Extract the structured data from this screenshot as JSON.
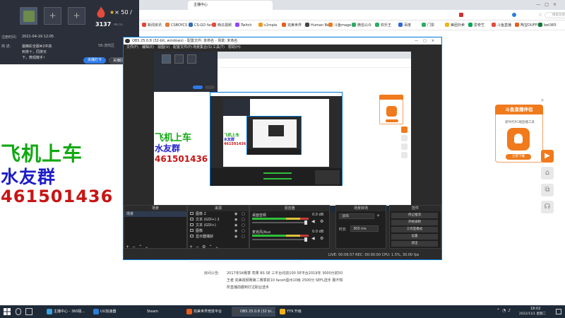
{
  "browser": {
    "active_tab_title": "主播中心",
    "bookmarks": [
      {
        "label": "新闻资讯",
        "color": "#e5462e"
      },
      {
        "label": "CSBOYCS",
        "color": "#e07b39"
      },
      {
        "label": "CS:GO fan",
        "color": "#2f6db5"
      },
      {
        "label": "西瓜视频",
        "color": "#e34b3b"
      },
      {
        "label": "Twitch",
        "color": "#9146ff"
      },
      {
        "label": "s1mple",
        "color": "#f29a1c"
      },
      {
        "label": "完美世界",
        "color": "#e85c1c"
      },
      {
        "label": "Human Be",
        "color": "#444444"
      },
      {
        "label": "斗鱼mage",
        "color": "#f07a1c"
      },
      {
        "label": "微信公众",
        "color": "#2aae67"
      },
      {
        "label": "欢乐王",
        "color": "#2aae67"
      },
      {
        "label": "百度",
        "color": "#3065e0"
      },
      {
        "label": "门票",
        "color": "#2aae67"
      },
      {
        "label": "美团外卖",
        "color": "#f2b316"
      },
      {
        "label": "爱奇艺",
        "color": "#00a550"
      },
      {
        "label": "斗鱼直播",
        "color": "#e34b3b"
      },
      {
        "label": "陶宝DUFFI",
        "color": "#e85c1c"
      },
      {
        "label": "bet365",
        "color": "#0f7a3a"
      }
    ],
    "search_placeholder": "搜索您感兴趣的内容"
  },
  "dark_panel": {
    "level_value": "3137",
    "level_sub": "96.55",
    "multiplier": "× 50 /",
    "reg_label": "注册时间：",
    "reg_date": "2021-04-19 12:05",
    "desc_label": "简    述:",
    "desc_line1": "最精彩全服#2中高",
    "desc_line2": "到排十，同排天",
    "desc_line3": "下，微观散手！",
    "tag_right": "5B·虎鸣区",
    "btn_primary": "关播打卡",
    "btn_secondary": "关播回播"
  },
  "overlay": {
    "line1": "飞机上车",
    "line2": "水友群",
    "line3": "461501436",
    "color_green": "#11a811",
    "color_blue": "#1c1cc8",
    "color_red": "#c81414"
  },
  "obs": {
    "title": "OBS 25.0.8 (32-bit, windows) - 配置文件: 未命名 - 场景: 未命名",
    "menu": [
      "文件(F)",
      "编辑(E)",
      "视图(V)",
      "配置文件(P)",
      "场景集合(S)",
      "工具(T)",
      "帮助(H)"
    ],
    "dock_scenes": "场景",
    "scenes": [
      "场景"
    ],
    "dock_sources": "来源",
    "sources": [
      "图像 2",
      "文本 (GDI+) 2",
      "文本 (GDI+)",
      "图像",
      "显示器捕获"
    ],
    "dock_mixer": "混音器",
    "mixer": [
      {
        "name": "桌面音频",
        "db": "0.0 dB"
      },
      {
        "name": "麦克风/Aux",
        "db": "0.0 dB"
      }
    ],
    "dock_transition": "场景转场",
    "transition_value": "淡出",
    "duration_label": "时长",
    "duration_value": "300 ms",
    "dock_controls": "控件",
    "controls": [
      "停止推流",
      "开始录制",
      "工作室模式",
      "设置",
      "退出"
    ],
    "status": "LIVE: 00:06:57  REC: 00:00:00  CPU: 1.5%, 30.00 fps"
  },
  "page_below": {
    "notice_label": "房间公告:",
    "notice_lines": [
      "2017年S4赛季 亮果 BS SE 三平台均前100 5E平台2019年 3000分前50",
      "王者 完美视频赛第二赛季前10 faceit监州10级 2500分 SEFL选手 服不知",
      "所直播前都到打过职业选手"
    ]
  },
  "promo": {
    "title": "斗鱼直播伴侣",
    "subtitle": "新时代PC端直播工具",
    "btn": "立即下载"
  },
  "taskbar": {
    "items": [
      {
        "label": "主播中心 - 360极...",
        "color": "#3aa0e0"
      },
      {
        "label": "UU加速器",
        "color": "#2a7fd6"
      },
      {
        "label": "Steam",
        "color": "#1b2838"
      },
      {
        "label": "完美世界竞技平台",
        "color": "#e85c1c"
      },
      {
        "label": "OBS 25.0.8 (32 bi...",
        "color": "#444444"
      },
      {
        "label": "YY9 升级",
        "color": "#f2b316"
      }
    ],
    "time": "18:02",
    "date": "2022/11/1 星期二"
  }
}
